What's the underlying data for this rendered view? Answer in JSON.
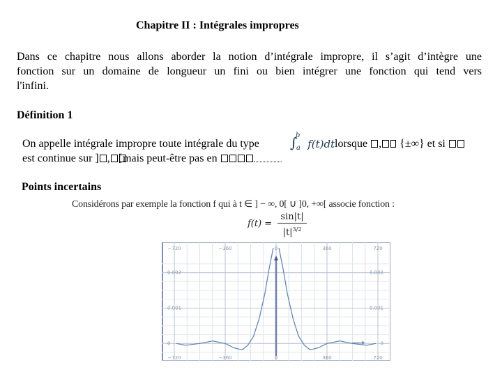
{
  "document": {
    "title": "Chapitre II : Intégrales impropres",
    "intro_paragraph": {
      "line1": "Dans ce chapitre nous allons aborder la notion d’intégrale impropre, il s’agit d’intègre une",
      "line2": "fonction sur un domaine de longueur un fini ou bien intégrer une fonction qui tend vers",
      "line3": "l'infini."
    },
    "definition": {
      "heading": "Définition 1",
      "line1_prefix": "On appelle intégrale impropre toute intégrale du type",
      "integral": {
        "sign": "∫",
        "upper": "b",
        "lower": "a",
        "body": "f(t)dt"
      },
      "line1_suffix_a": "lorsque",
      "line1_suffix_b": "{±∞} et si",
      "line2_prefix": "est continue sur ]",
      "line2_mid": "mais peut-être pas en"
    },
    "points_incertains": {
      "heading": "Points incertains",
      "example_text": "Considérons par exemple la fonction f qui à t ∈ ] − ∞, 0[ ∪ ]0, +∞[ associe fonction :",
      "formula": {
        "lhs": "f(t) =",
        "numerator": "sin|t|",
        "denominator": "|t|",
        "exponent": "3/2"
      }
    }
  },
  "chart_data": {
    "type": "line",
    "title": "",
    "xlabel": "",
    "ylabel": "",
    "xlim": [
      -720,
      720
    ],
    "ylim": [
      -0.00025,
      0.0027
    ],
    "x_ticks": [
      -720,
      -360,
      0,
      360,
      720
    ],
    "x_tick_labels": [
      "−720",
      "−360",
      "0",
      "360",
      "720"
    ],
    "y_ticks": [
      0,
      0.001,
      0.002
    ],
    "y_tick_labels": [
      "0",
      "0.001",
      "0.002"
    ],
    "grid": true,
    "series": [
      {
        "name": "f(t) = sin|t| / |t|^(3/2)",
        "color": "#5b7fae",
        "x": [
          -705,
          -640,
          -540,
          -450,
          -360,
          -300,
          -240,
          -200,
          -160,
          -120,
          -80,
          -50,
          -30,
          -20,
          20,
          30,
          50,
          80,
          120,
          160,
          200,
          240,
          300,
          360,
          450,
          540,
          640,
          705
        ],
        "y": [
          0.0,
          -5e-05,
          0.0,
          7e-05,
          0.0,
          -0.00012,
          -0.00018,
          -5e-05,
          0.0002,
          0.0007,
          0.0014,
          0.0021,
          0.0025,
          0.0027,
          0.0027,
          0.0025,
          0.0021,
          0.0014,
          0.0007,
          0.0002,
          -5e-05,
          -0.00018,
          -0.00012,
          0.0,
          7e-05,
          0.0,
          -5e-05,
          0.0
        ]
      }
    ],
    "annotations": [
      "vertical arrow at x = 0 (asymptote)",
      "horizontal arrow near x = 600"
    ]
  }
}
